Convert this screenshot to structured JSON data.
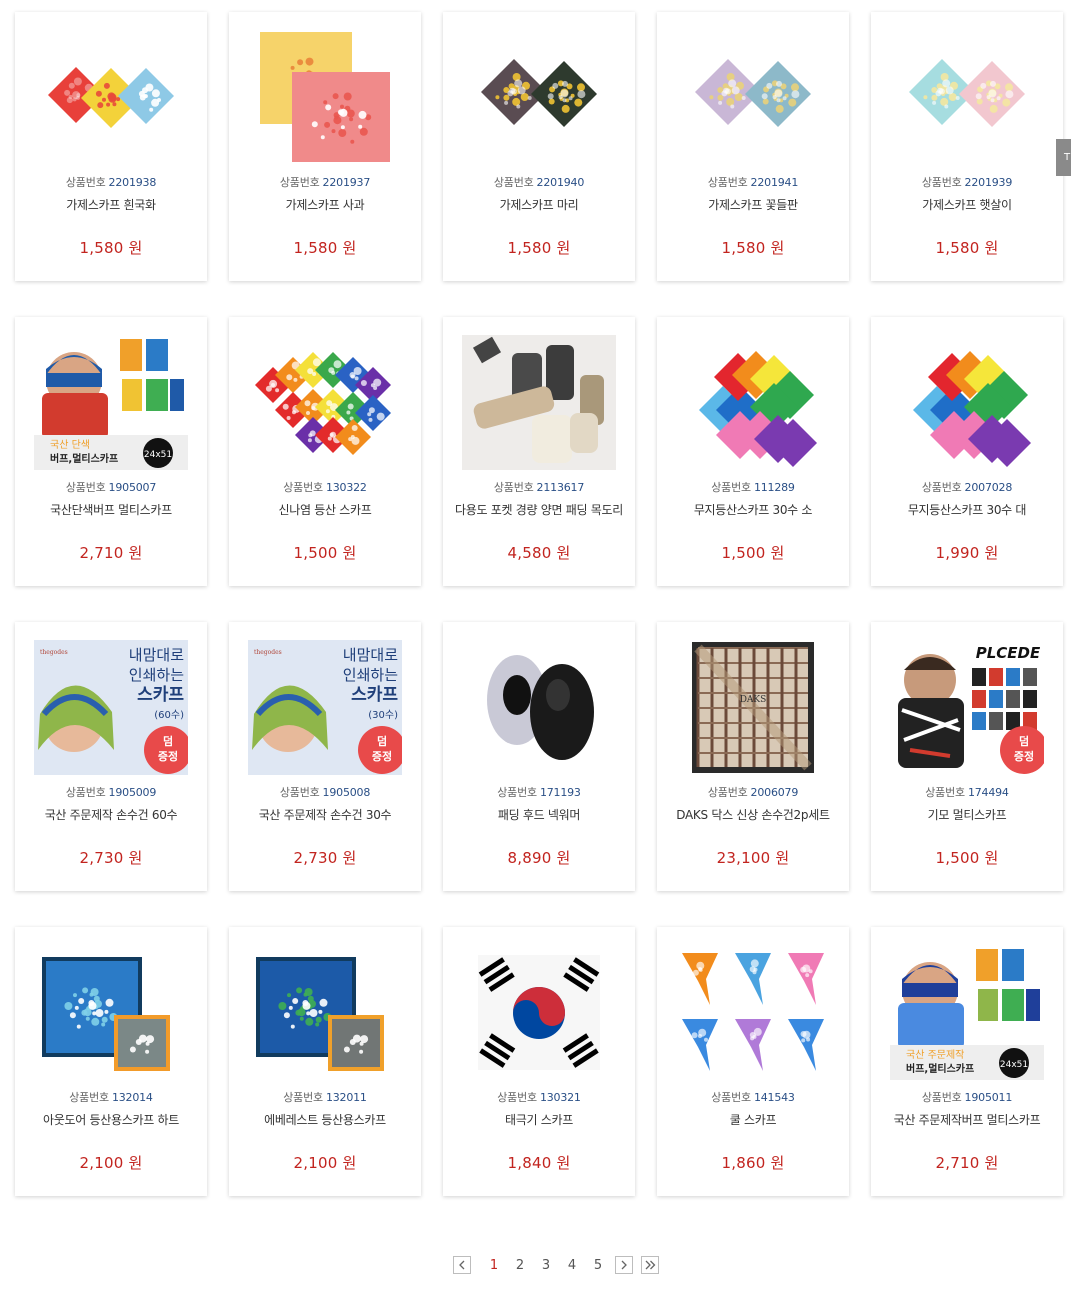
{
  "code_label": "상품번호",
  "currency": "원",
  "side_tab_label": "T",
  "products": [
    {
      "code": "2201938",
      "name": "가제스카프 흰국화",
      "price": "1,580",
      "thumb": "bandana-floral-trio",
      "colors": [
        "#e8403a",
        "#f3d23a",
        "#8ec9e6"
      ]
    },
    {
      "code": "2201937",
      "name": "가제스카프 사과",
      "price": "1,580",
      "thumb": "gauze-apple",
      "colors": [
        "#f6d36a",
        "#f08a8a",
        "#e9564f"
      ]
    },
    {
      "code": "2201940",
      "name": "가제스카프 마리",
      "price": "1,580",
      "thumb": "bandana-floral-duo",
      "colors": [
        "#5a4c52",
        "#2e3a2e",
        "#f0c333"
      ]
    },
    {
      "code": "2201941",
      "name": "가제스카프 꽃들판",
      "price": "1,580",
      "thumb": "bandana-floral-duo",
      "colors": [
        "#c9b7d6",
        "#8db9c9",
        "#e9d27a"
      ]
    },
    {
      "code": "2201939",
      "name": "가제스카프 햇살이",
      "price": "1,580",
      "thumb": "bandana-floral-duo",
      "colors": [
        "#a6dde0",
        "#f2c7cf",
        "#f4e7a0"
      ]
    },
    {
      "code": "1905007",
      "name": "국산단색버프 멀티스카프",
      "price": "2,710",
      "thumb": "buff-model",
      "badge1": "국산 단색",
      "badge2": "버프,멀티스카프",
      "badge_size": "24x51",
      "colors": [
        "#1f5aa8",
        "#d23b2e",
        "#f0c333"
      ]
    },
    {
      "code": "130322",
      "name": "신나염 등산 스카프",
      "price": "1,500",
      "thumb": "rainbow-bandanas",
      "colors": [
        "#e32b2b",
        "#f28c1c",
        "#f4e03a",
        "#3aa84b",
        "#2a62c4",
        "#6a2fa8"
      ]
    },
    {
      "code": "2113617",
      "name": "다용도 포켓 경량 양면 패딩 목도리",
      "price": "4,580",
      "thumb": "padded-scarves",
      "colors": [
        "#cdb89a",
        "#4a4a4a",
        "#f1ecdf",
        "#a9987a"
      ]
    },
    {
      "code": "111289",
      "name": "무지등산스카프 30수 소",
      "price": "1,500",
      "thumb": "solid-diamonds",
      "colors": [
        "#e3262e",
        "#f28c1c",
        "#f5e63a",
        "#2fa84f",
        "#1f6ec8",
        "#5bb8e8",
        "#f07ab5",
        "#7a3ab0"
      ]
    },
    {
      "code": "2007028",
      "name": "무지등산스카프 30수 대",
      "price": "1,990",
      "thumb": "solid-diamonds",
      "colors": [
        "#e3262e",
        "#f28c1c",
        "#f5e63a",
        "#2fa84f",
        "#1f6ec8",
        "#5bb8e8",
        "#f07ab5",
        "#7a3ab0"
      ]
    },
    {
      "code": "1905009",
      "name": "국산 주문제작 손수건 60수",
      "price": "2,730",
      "thumb": "print-promo",
      "brand": "thegodes",
      "promo1": "내맘대로",
      "promo2": "인쇄하는",
      "promo3": "스카프",
      "promo_spec": "(60수)",
      "stamp1": "덤",
      "stamp2": "증정",
      "colors": [
        "#2a5fae",
        "#8fb64a",
        "#e84a4a"
      ]
    },
    {
      "code": "1905008",
      "name": "국산 주문제작 손수건 30수",
      "price": "2,730",
      "thumb": "print-promo",
      "brand": "thegodes",
      "promo1": "내맘대로",
      "promo2": "인쇄하는",
      "promo3": "스카프",
      "promo_spec": "(30수)",
      "stamp1": "덤",
      "stamp2": "증정",
      "colors": [
        "#2a5fae",
        "#8fb64a",
        "#e84a4a"
      ]
    },
    {
      "code": "171193",
      "name": "패딩 후드 넥워머",
      "price": "8,890",
      "thumb": "hood-warmer",
      "colors": [
        "#c9c9d6",
        "#1a1a1a"
      ]
    },
    {
      "code": "2006079",
      "name": "DAKS 닥스 신상 손수건2p세트",
      "price": "23,100",
      "thumb": "daks-box",
      "box_label": "DAKS",
      "colors": [
        "#6b4a3a",
        "#d8c9b6",
        "#8a6a55"
      ]
    },
    {
      "code": "174494",
      "name": "기모 멀티스카프",
      "price": "1,500",
      "thumb": "plcede-model",
      "brand": "PLCEDE",
      "stamp1": "덤",
      "stamp2": "증정",
      "colors": [
        "#222222",
        "#d23b2e",
        "#ffffff"
      ]
    },
    {
      "code": "132014",
      "name": "아웃도어 등산용스카프 하트",
      "price": "2,100",
      "thumb": "outdoor-scarf",
      "colors": [
        "#2b7bc7",
        "#7fd0e8",
        "#f29b2a"
      ]
    },
    {
      "code": "132011",
      "name": "에베레스트 등산용스카프",
      "price": "2,100",
      "thumb": "outdoor-scarf",
      "colors": [
        "#1c5aa8",
        "#3fae52",
        "#f0a02a"
      ]
    },
    {
      "code": "130321",
      "name": "태극기 스카프",
      "price": "1,840",
      "thumb": "taegukgi",
      "colors": [
        "#cd2e3a",
        "#0047a0",
        "#000000"
      ]
    },
    {
      "code": "141543",
      "name": "쿨 스카프",
      "price": "1,860",
      "thumb": "cool-scarves",
      "colors": [
        "#f28c1c",
        "#4aa3e0",
        "#f07ab5",
        "#b07ad8",
        "#f5c12a",
        "#3a8ae0"
      ]
    },
    {
      "code": "1905011",
      "name": "국산 주문제작버프 멀티스카프",
      "price": "2,710",
      "thumb": "buff-model",
      "badge1": "국산 주문제작",
      "badge2": "버프,멀티스카프",
      "badge_size": "24x51",
      "colors": [
        "#1f3f9a",
        "#4a8ae0",
        "#8fb64a"
      ]
    }
  ],
  "pagination": {
    "prev_label": "<",
    "pages": [
      "1",
      "2",
      "3",
      "4",
      "5"
    ],
    "active": "1",
    "next_label": ">",
    "last_label": "»"
  }
}
